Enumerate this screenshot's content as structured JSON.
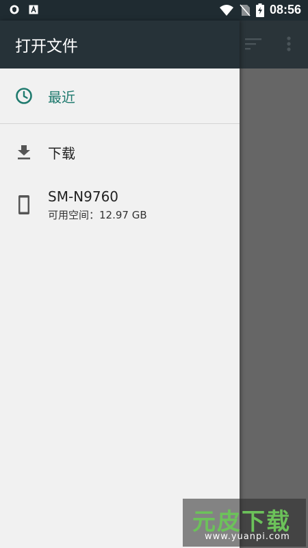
{
  "status_bar": {
    "time": "08:56",
    "icons": [
      "shield-notification-icon",
      "a-notification-icon",
      "wifi-icon",
      "no-sim-icon",
      "battery-charging-icon"
    ]
  },
  "drawer": {
    "title": "打开文件",
    "recent": {
      "label": "最近",
      "icon": "clock-icon"
    },
    "download": {
      "label": "下载",
      "icon": "download-icon"
    },
    "device": {
      "label": "SM-N9760",
      "sub": "可用空间：12.97 GB",
      "icon": "phone-icon"
    }
  },
  "app_toolbar": {
    "icons": [
      "sort-icon",
      "more-vert-icon"
    ]
  },
  "watermark": {
    "brand": "元皮下载",
    "url": "www.yuanpi.com"
  },
  "colors": {
    "accent": "#1f7a6e",
    "header": "#263238",
    "drawer_bg": "#f1f1f1",
    "scrim": "#666666"
  }
}
